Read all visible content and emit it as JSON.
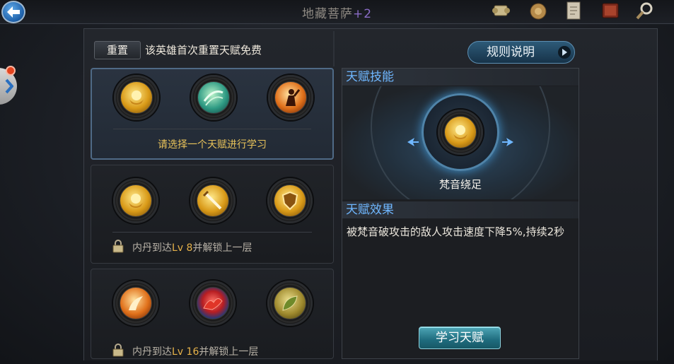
{
  "header": {
    "title": "地藏菩萨",
    "title_suffix": "+2",
    "icons": [
      "scroll-icon",
      "coin-bag-icon",
      "document-icon",
      "book-icon",
      "search-icon"
    ]
  },
  "toolbar": {
    "reset_label": "重置",
    "reset_hint": "该英雄首次重置天赋免费",
    "rules_label": "规则说明"
  },
  "tiers": [
    {
      "talents": [
        {
          "icon": "golden-hand-icon",
          "color": "gold"
        },
        {
          "icon": "green-wind-icon",
          "color": "green"
        },
        {
          "icon": "fire-figure-icon",
          "color": "fire"
        }
      ],
      "text": "请选择一个天赋进行学习"
    },
    {
      "talents": [
        {
          "icon": "golden-hand-icon",
          "color": "gold"
        },
        {
          "icon": "sword-icon",
          "color": "gold"
        },
        {
          "icon": "shield-icon",
          "color": "gold"
        }
      ],
      "lock_prefix": "内丹到达",
      "lock_level": "Lv 8",
      "lock_suffix": "并解锁上一层"
    },
    {
      "talents": [
        {
          "icon": "phoenix-icon",
          "color": "fire"
        },
        {
          "icon": "red-dragon-icon",
          "color": "red"
        },
        {
          "icon": "leaf-icon",
          "color": "leaf"
        }
      ],
      "lock_prefix": "内丹到达",
      "lock_level": "Lv 16",
      "lock_suffix": "并解锁上一层"
    }
  ],
  "detail": {
    "skill_header": "天赋技能",
    "skill_name": "梵音绕足",
    "effect_header": "天赋效果",
    "effect_text": "被梵音破攻击的敌人攻击速度下降5%,持续2秒",
    "learn_label": "学习天赋"
  },
  "colors": {
    "header_text": "#6fb7ff",
    "tier_prompt": "#e9c35a",
    "level_highlight": "#e6b24a",
    "title_suffix": "#8a6cc6"
  }
}
